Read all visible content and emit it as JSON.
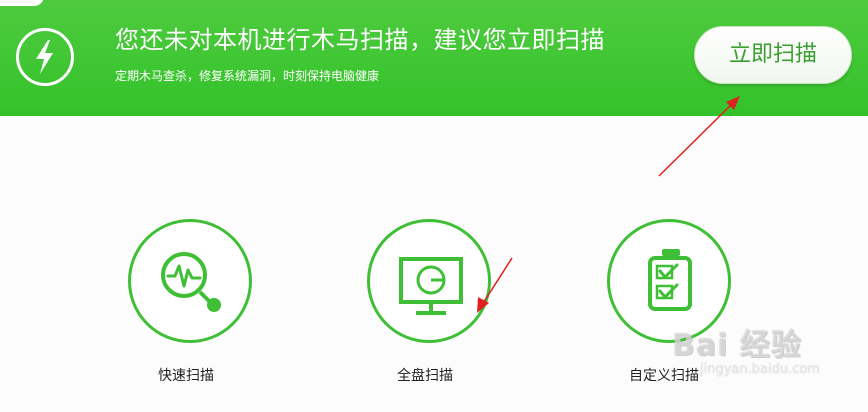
{
  "banner": {
    "headline": "您还未对本机进行木马扫描，建议您立即扫描",
    "subline": "定期木马查杀，修复系统漏洞，时刻保持电脑健康",
    "scan_now_label": "立即扫描",
    "icon": "lightning-bolt-icon",
    "background_color": "#3dc534"
  },
  "scan_options": [
    {
      "label": "快速扫描",
      "icon": "pulse-magnifier-icon"
    },
    {
      "label": "全盘扫描",
      "icon": "monitor-icon"
    },
    {
      "label": "自定义扫描",
      "icon": "checklist-clipboard-icon"
    }
  ],
  "accent_color": "#3fbf36",
  "annotation_color": "#e02020",
  "watermark": {
    "main": "Bai 经验",
    "url": "jingyan.baidu.com"
  }
}
